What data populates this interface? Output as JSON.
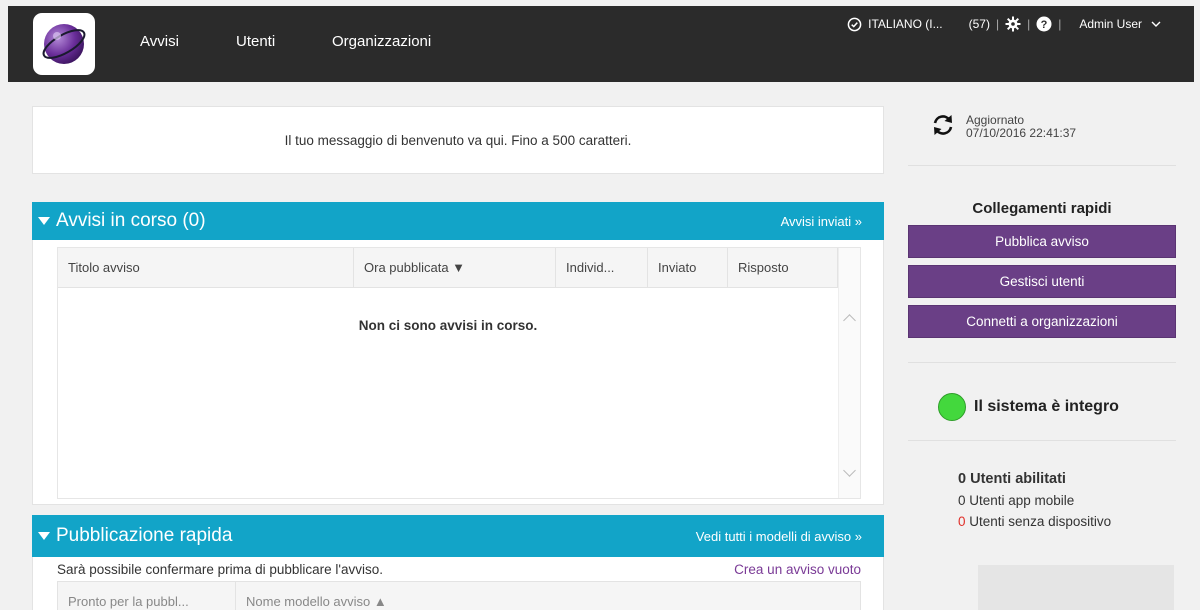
{
  "nav": {
    "items": [
      "Avvisi",
      "Utenti",
      "Organizzazioni"
    ],
    "language": "ITALIANO (I...",
    "count": "(57)",
    "user": "Admin User"
  },
  "welcome": {
    "message": "Il tuo messaggio di benvenuto va qui. Fino a 500 caratteri."
  },
  "alerts": {
    "title": "Avvisi in corso (0)",
    "link": "Avvisi inviati »",
    "columns": [
      "Titolo avviso",
      "Ora pubblicata ▼",
      "Individ...",
      "Inviato",
      "Risposto"
    ],
    "empty": "Non ci sono avvisi in corso."
  },
  "quick": {
    "title": "Pubblicazione rapida",
    "link": "Vedi tutti i modelli di avviso »",
    "note": "Sarà possibile confermare prima di pubblicare l'avviso.",
    "create_link": "Crea un avviso vuoto",
    "columns": [
      "Pronto per la pubbl...",
      "Nome modello avviso ▲"
    ]
  },
  "sidebar": {
    "updated_label": "Aggiornato",
    "updated_time": "07/10/2016 22:41:37",
    "quick_links_title": "Collegamenti rapidi",
    "buttons": [
      "Pubblica avviso",
      "Gestisci utenti",
      "Connetti a organizzazioni"
    ],
    "health": "Il sistema è integro",
    "users_enabled": "0 Utenti abilitati",
    "mobile_users": "0 Utenti app mobile",
    "no_device_count": "0",
    "no_device_label": "Utenti senza dispositivo"
  },
  "colors": {
    "topbar": "#2b2b2b",
    "section": "#12a4c8",
    "button": "#6a3f86",
    "health": "#43d83d"
  }
}
